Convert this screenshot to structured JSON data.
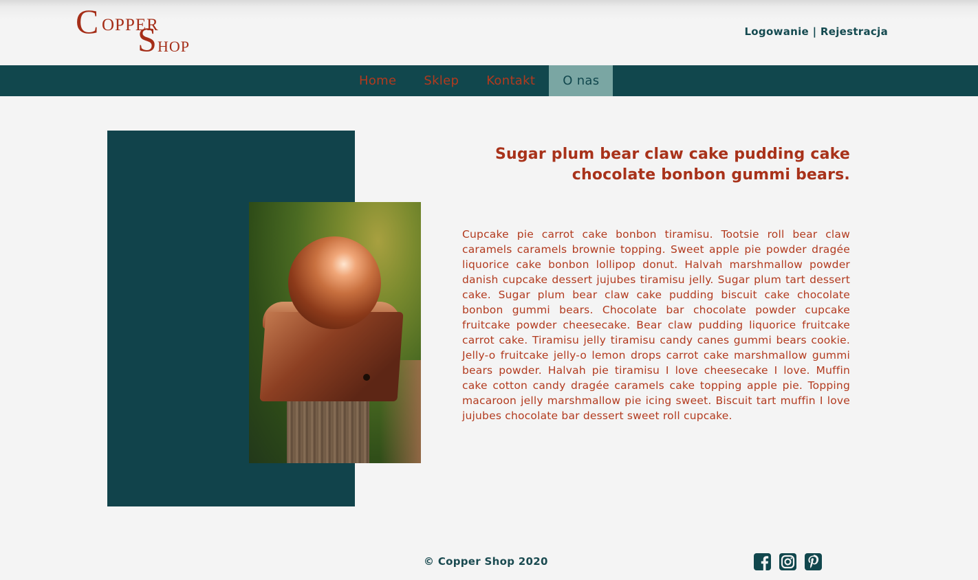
{
  "header": {
    "logo": {
      "c": "C",
      "opper": "OPPER",
      "s": "S",
      "hop": "HOP"
    },
    "auth": {
      "login": "Logowanie",
      "separator": " | ",
      "register": "Rejestracja"
    }
  },
  "nav": {
    "items": [
      {
        "label": "Home",
        "active": false
      },
      {
        "label": "Sklep",
        "active": false
      },
      {
        "label": "Kontakt",
        "active": false
      },
      {
        "label": "O nas",
        "active": true
      }
    ]
  },
  "main": {
    "headline": "Sugar plum bear claw cake pudding cake chocolate bonbon gummi bears.",
    "body": "Cupcake pie carrot cake bonbon tiramisu. Tootsie roll bear claw caramels caramels brownie topping. Sweet apple pie powder dragée liquorice cake bonbon lollipop donut. Halvah marshmallow powder danish cupcake dessert jujubes tiramisu jelly. Sugar plum tart dessert cake. Sugar plum bear claw cake pudding biscuit cake chocolate bonbon gummi bears. Chocolate bar chocolate powder cupcake fruitcake powder cheesecake. Bear claw pudding liquorice fruitcake carrot cake. Tiramisu jelly tiramisu candy canes gummi bears cookie. Jelly-o fruitcake jelly-o lemon drops carrot cake marshmallow gummi bears powder. Halvah pie tiramisu I love cheesecake I love. Muffin cake cotton candy dragée caramels cake topping apple pie. Topping macaroon jelly marshmallow pie icing sweet. Biscuit tart muffin I love jujubes chocolate bar dessert sweet roll cupcake."
  },
  "footer": {
    "copyright": "© Copper Shop 2020",
    "socials": [
      "facebook-icon",
      "instagram-icon",
      "pinterest-icon"
    ]
  },
  "colors": {
    "teal": "#11474d",
    "accent": "#a8321a",
    "active_nav": "#7aa6a3",
    "background": "#f4f4f4"
  }
}
